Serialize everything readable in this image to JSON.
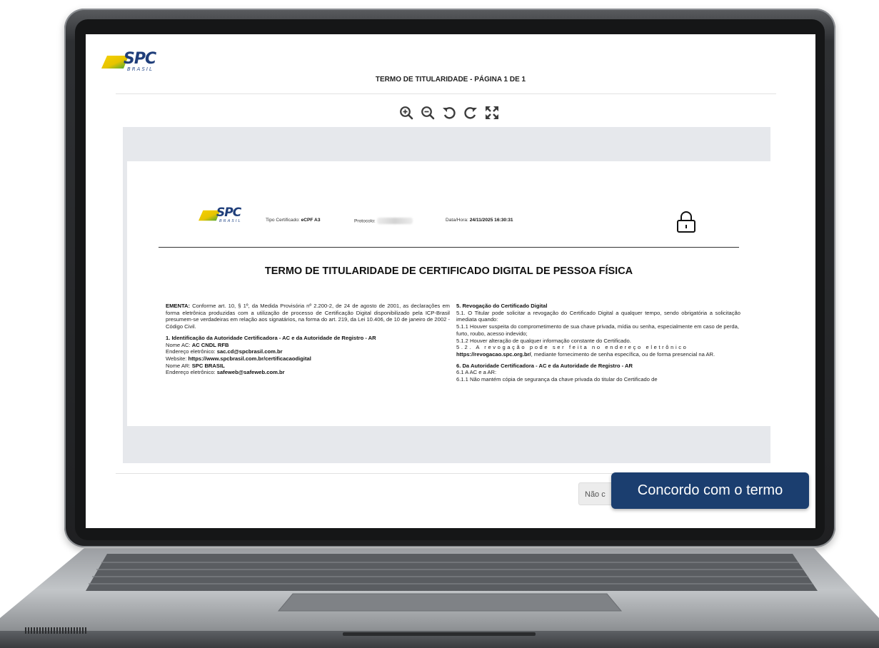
{
  "header": {
    "logo_text": "SPC",
    "logo_subtext": "BRASIL",
    "page_title": "TERMO DE TITULARIDADE - PÁGINA 1 DE 1"
  },
  "toolbar": {
    "icons": [
      "zoom-in-icon",
      "zoom-out-icon",
      "rotate-left-icon",
      "rotate-right-icon",
      "fullscreen-icon"
    ]
  },
  "document": {
    "logo_text": "SPC",
    "logo_subtext": "BRASIL",
    "meta": {
      "tipo_label": "Tipo Certificado: ",
      "tipo_value": "eCPF A3",
      "protocolo_label": "Protocolo:",
      "datahora_label": "Data/Hora: ",
      "datahora_value": "24/11/2025 16:30:31"
    },
    "title": "TERMO DE TITULARIDADE DE CERTIFICADO DIGITAL DE PESSOA FÍSICA",
    "left": {
      "ementa_label": "EMENTA:",
      "ementa_text": " Conforme art. 10, § 1º, da Medida Provisória nº 2.200-2, de 24 de agosto de 2001, as declarações em forma eletrônica produzidas com a utilização de processo de Certificação Digital disponibilizado pela ICP-Brasil  presumem-se verdadeiras em relação aos signatários, na forma do art. 219, da Lei 10.406, de 10 de janeiro de 2002 - Código Civil.",
      "s1_title": "1. Identificação da Autoridade Certificadora - AC e da Autoridade de Registro - AR",
      "nome_ac_label": "Nome AC: ",
      "nome_ac_value": "AC CNDL RFB",
      "email1_label": "Endereço eletrônico: ",
      "email1_value": "sac.cd@spcbrasil.com.br",
      "website_label": "Website: ",
      "website_value": "https://www.spcbrasil.com.br/certificacaodigital",
      "nome_ar_label": "Nome AR: ",
      "nome_ar_value": "SPC BRASIL",
      "email2_label": "Endereço eletrônico: ",
      "email2_value": "safeweb@safeweb.com.br"
    },
    "right": {
      "s5_title": "5. Revogação do Certificado Digital",
      "s5_1": "5.1. O Titular pode solicitar a revogação do Certificado Digital a qualquer tempo, sendo obrigatória a solicitação imediata quando:",
      "s5_1_1": "5.1.1 Houver suspeita do comprometimento de sua chave privada, mídia ou senha, especialmente em caso de perda, furto, roubo, acesso indevido;",
      "s5_1_2": "5.1.2 Houver alteração de qualquer informação constante do Certificado.",
      "s5_2_a": "5.2. A revogação pode ser feita no endereço eletrônico",
      "s5_2_link": "https://revogacao.spc.org.br/",
      "s5_2_b": ", mediante fornecimento de senha específica, ou de forma presencial na AR.",
      "s6_title": "6. Da Autoridade Certificadora - AC e da Autoridade de Registro - AR",
      "s6_1": "6.1 A AC e a AR:",
      "s6_1_1": "6.1.1 Não mantém cópia de segurança da chave privada do titular do Certificado de"
    }
  },
  "footer": {
    "reject_label": "Não c",
    "accept_label": "Concordo com o termo"
  },
  "colors": {
    "brand_blue": "#1b3e6f",
    "logo_yellow": "#f2c200",
    "logo_green": "#39a935",
    "viewer_bg": "#e6e8ec"
  }
}
